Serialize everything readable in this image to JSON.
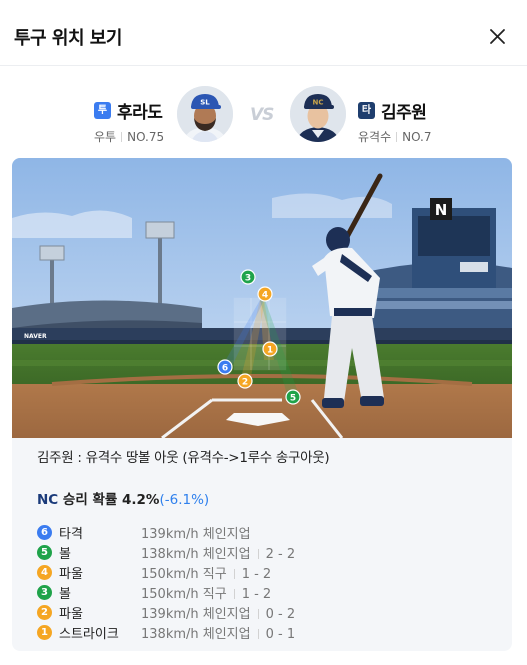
{
  "header": {
    "title": "투구 위치 보기",
    "close_label": "×"
  },
  "matchup": {
    "vs_label": "VS",
    "pitcher": {
      "badge": "투",
      "name": "후라도",
      "position": "우투",
      "number": "NO.75",
      "cap_letters": "SL",
      "cap_color": "#2b56b3"
    },
    "batter": {
      "badge": "타",
      "name": "김주원",
      "position": "유격수",
      "number": "NO.7",
      "cap_letters": "NC",
      "cap_color": "#1d2f55"
    }
  },
  "scene": {
    "board_letter": "N",
    "banner_text": "NAVER"
  },
  "play_result": "김주원 : 유격수 땅볼 아웃 (유격수->1루수 송구아웃)",
  "win_probability": {
    "team": "NC",
    "label": "승리 확률",
    "value": "4.2%",
    "delta": "(-6.1%)"
  },
  "colors": {
    "hit": "#3b7cf0",
    "ball": "#1fa34a",
    "strike": "#f5a623",
    "foul": "#f5a623"
  },
  "pitches": [
    {
      "order": "6",
      "result": "타격",
      "speed": "139km/h",
      "type": "체인지업",
      "count": "",
      "kind": "hit"
    },
    {
      "order": "5",
      "result": "볼",
      "speed": "138km/h",
      "type": "체인지업",
      "count": "2 - 2",
      "kind": "ball"
    },
    {
      "order": "4",
      "result": "파울",
      "speed": "150km/h",
      "type": "직구",
      "count": "1 - 2",
      "kind": "foul"
    },
    {
      "order": "3",
      "result": "볼",
      "speed": "150km/h",
      "type": "직구",
      "count": "1 - 2",
      "kind": "ball"
    },
    {
      "order": "2",
      "result": "파울",
      "speed": "139km/h",
      "type": "체인지업",
      "count": "0 - 2",
      "kind": "foul"
    },
    {
      "order": "1",
      "result": "스트라이크",
      "speed": "138km/h",
      "type": "체인지업",
      "count": "0 - 1",
      "kind": "strike"
    }
  ]
}
